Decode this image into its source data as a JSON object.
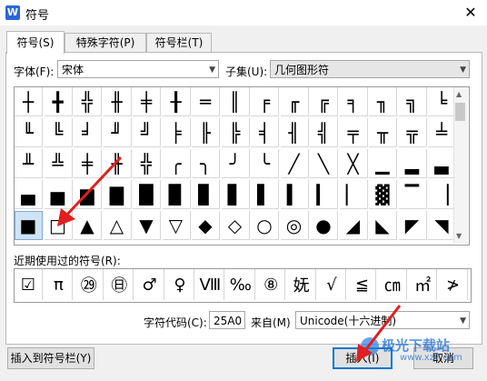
{
  "window": {
    "title": "符号",
    "app_icon": "W"
  },
  "tabs": [
    {
      "label": "符号(S)"
    },
    {
      "label": "特殊字符(P)"
    },
    {
      "label": "符号栏(T)"
    }
  ],
  "font": {
    "label": "字体(F):",
    "value": "宋体"
  },
  "subset": {
    "label": "子集(U):",
    "value": "几何图形符"
  },
  "grid_rows": [
    [
      "┼",
      "╋",
      "╬",
      "╫",
      "╪",
      "╂",
      "═",
      "║",
      "╒",
      "╓",
      "╔",
      "╕",
      "╖",
      "╗",
      "╘"
    ],
    [
      "╙",
      "╚",
      "╛",
      "╜",
      "╝",
      "╞",
      "╟",
      "╠",
      "╡",
      "╢",
      "╣",
      "╤",
      "╥",
      "╦",
      "╧"
    ],
    [
      "╨",
      "╩",
      "╪",
      "╫",
      "╬",
      "╭",
      "╮",
      "╯",
      "╰",
      "╱",
      "╲",
      "╳",
      "▁",
      "▂",
      "▃"
    ],
    [
      "▄",
      "▅",
      "▆",
      "▇",
      "█",
      "▉",
      "▊",
      "▋",
      "▌",
      "▍",
      "▎",
      "▏",
      "▓",
      "▔",
      "▕"
    ],
    [
      "■",
      "□",
      "▲",
      "△",
      "▼",
      "▽",
      "◆",
      "◇",
      "○",
      "◎",
      "●",
      "◢",
      "◣",
      "◤",
      "◥"
    ]
  ],
  "recent": {
    "label": "近期使用过的符号(R):",
    "items": [
      "☑",
      "π",
      "㉙",
      "㊐",
      "♂",
      "♀",
      "Ⅷ",
      "‰",
      "⑧",
      "妩",
      "√",
      "≦",
      "㎝",
      "㎡",
      "≯"
    ]
  },
  "char_code": {
    "label": "字符代码(C):",
    "value": "25A0",
    "from_label": "来自(M)",
    "from_value": "Unicode(十六进制)"
  },
  "buttons": {
    "insert_to_bar": "插入到符号栏(Y)",
    "insert": "插入(I)",
    "cancel": "取消"
  },
  "watermark": {
    "text": "极光下载站",
    "url": "www.xz7.com"
  }
}
